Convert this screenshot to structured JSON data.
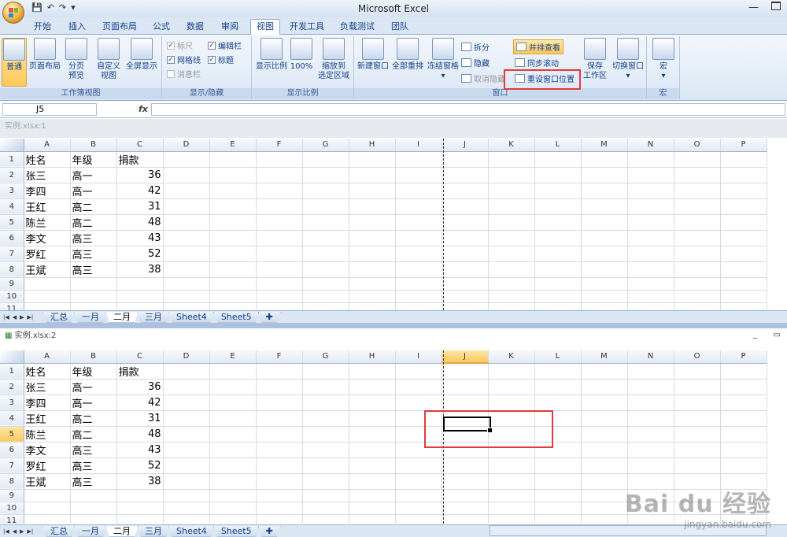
{
  "app_title": "Microsoft Excel",
  "tabs": [
    "开始",
    "插入",
    "页面布局",
    "公式",
    "数据",
    "审阅",
    "视图",
    "开发工具",
    "负载测试",
    "团队"
  ],
  "active_tab": "视图",
  "ribbon": {
    "workbook_views": {
      "label": "工作簿视图",
      "buttons": [
        {
          "line1": "普通",
          "line2": ""
        },
        {
          "line1": "页面布局",
          "line2": ""
        },
        {
          "line1": "分页",
          "line2": "预览"
        },
        {
          "line1": "自定义",
          "line2": "视图"
        },
        {
          "line1": "全屏显示",
          "line2": ""
        }
      ]
    },
    "show_hide": {
      "label": "显示/隐藏",
      "ruler": "标尺",
      "gridlines": "网格线",
      "message_bar": "消息栏",
      "formula_bar": "编辑栏",
      "headings": "标题"
    },
    "zoom": {
      "label": "显示比例",
      "zoom_btn": "显示比例",
      "pct_btn": "100%",
      "sel_line1": "缩放到",
      "sel_line2": "选定区域"
    },
    "window": {
      "label": "窗口",
      "new_window": "新建窗口",
      "arrange_all": "全部重排",
      "freeze": "冻结窗格",
      "split": "拆分",
      "hide": "隐藏",
      "unhide": "取消隐藏",
      "side_by_side": "并排查看",
      "sync_scroll": "同步滚动",
      "reset_position": "重设窗口位置",
      "save_ws_line1": "保存",
      "save_ws_line2": "工作区",
      "switch": "切换窗口"
    },
    "macros": {
      "label": "宏",
      "btn": "宏"
    }
  },
  "name_box": "J5",
  "fx_label": "fx",
  "top_pane": {
    "title": "实例.xlsx:1"
  },
  "bottom_pane": {
    "title": "实例.xlsx:2"
  },
  "columns": [
    "A",
    "B",
    "C",
    "D",
    "E",
    "F",
    "G",
    "H",
    "I",
    "J",
    "K",
    "L",
    "M",
    "N",
    "O",
    "P"
  ],
  "rows": [
    [
      "姓名",
      "年级",
      "捐款"
    ],
    [
      "张三",
      "高一",
      "36"
    ],
    [
      "李四",
      "高一",
      "42"
    ],
    [
      "王红",
      "高二",
      "31"
    ],
    [
      "陈兰",
      "高二",
      "48"
    ],
    [
      "李文",
      "高三",
      "43"
    ],
    [
      "罗红",
      "高三",
      "52"
    ],
    [
      "王斌",
      "高三",
      "38"
    ],
    [
      "",
      "",
      ""
    ],
    [
      "",
      "",
      ""
    ],
    [
      "",
      "",
      ""
    ],
    [
      "",
      "",
      ""
    ],
    [
      "",
      "",
      ""
    ]
  ],
  "sheets": [
    "汇总",
    "一月",
    "二月",
    "三月",
    "Sheet4",
    "Sheet5"
  ],
  "active_sheet": "二月",
  "watermark": {
    "brand": "Bai du 经验",
    "url": "jingyan.baidu.com"
  }
}
